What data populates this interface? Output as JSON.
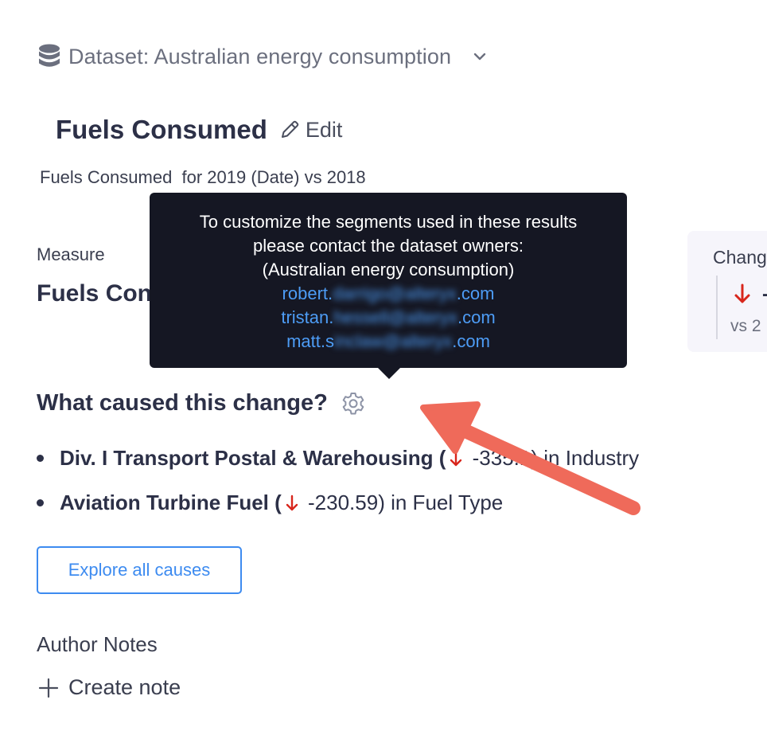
{
  "dataset": {
    "label": "Dataset: Australian energy consumption",
    "icon": "database-icon",
    "dropdown_icon": "chevron-down-icon"
  },
  "header": {
    "title": "Fuels Consumed",
    "edit_label": "Edit",
    "subtitle": "Fuels Consumed  for 2019 (Date) vs 2018"
  },
  "measure": {
    "label": "Measure",
    "value": "Fuels Con"
  },
  "change_card": {
    "label": "Chang",
    "value": "-",
    "vs": "vs 2"
  },
  "tooltip": {
    "line1": "To customize the segments used in these results",
    "line2": "please contact the dataset owners:",
    "line3": "(Australian energy consumption)",
    "emails": [
      {
        "prefix": "robert.",
        "hidden": "darrigo@alteryx",
        "suffix": ".com"
      },
      {
        "prefix": "tristan.",
        "hidden": "hessell@alteryx",
        "suffix": ".com"
      },
      {
        "prefix": "matt.s",
        "hidden": "inclaw@alteryx",
        "suffix": ".com"
      }
    ]
  },
  "causes": {
    "title": "What caused this change?",
    "items": [
      {
        "segment": "Div. I Transport Postal & Warehousing",
        "open": " (",
        "value": " -335.1)",
        "dimension": " in Industry"
      },
      {
        "segment": "Aviation Turbine Fuel",
        "open": " (",
        "value": " -230.59)",
        "dimension": " in Fuel Type"
      }
    ],
    "explore_label": "Explore all causes"
  },
  "notes": {
    "label": "Author Notes",
    "create_label": "Create note"
  },
  "colors": {
    "accent_blue": "#3d8bf0",
    "down_red": "#d8261c",
    "annotation_arrow": "#ef6a5a",
    "tooltip_bg": "#151723"
  }
}
